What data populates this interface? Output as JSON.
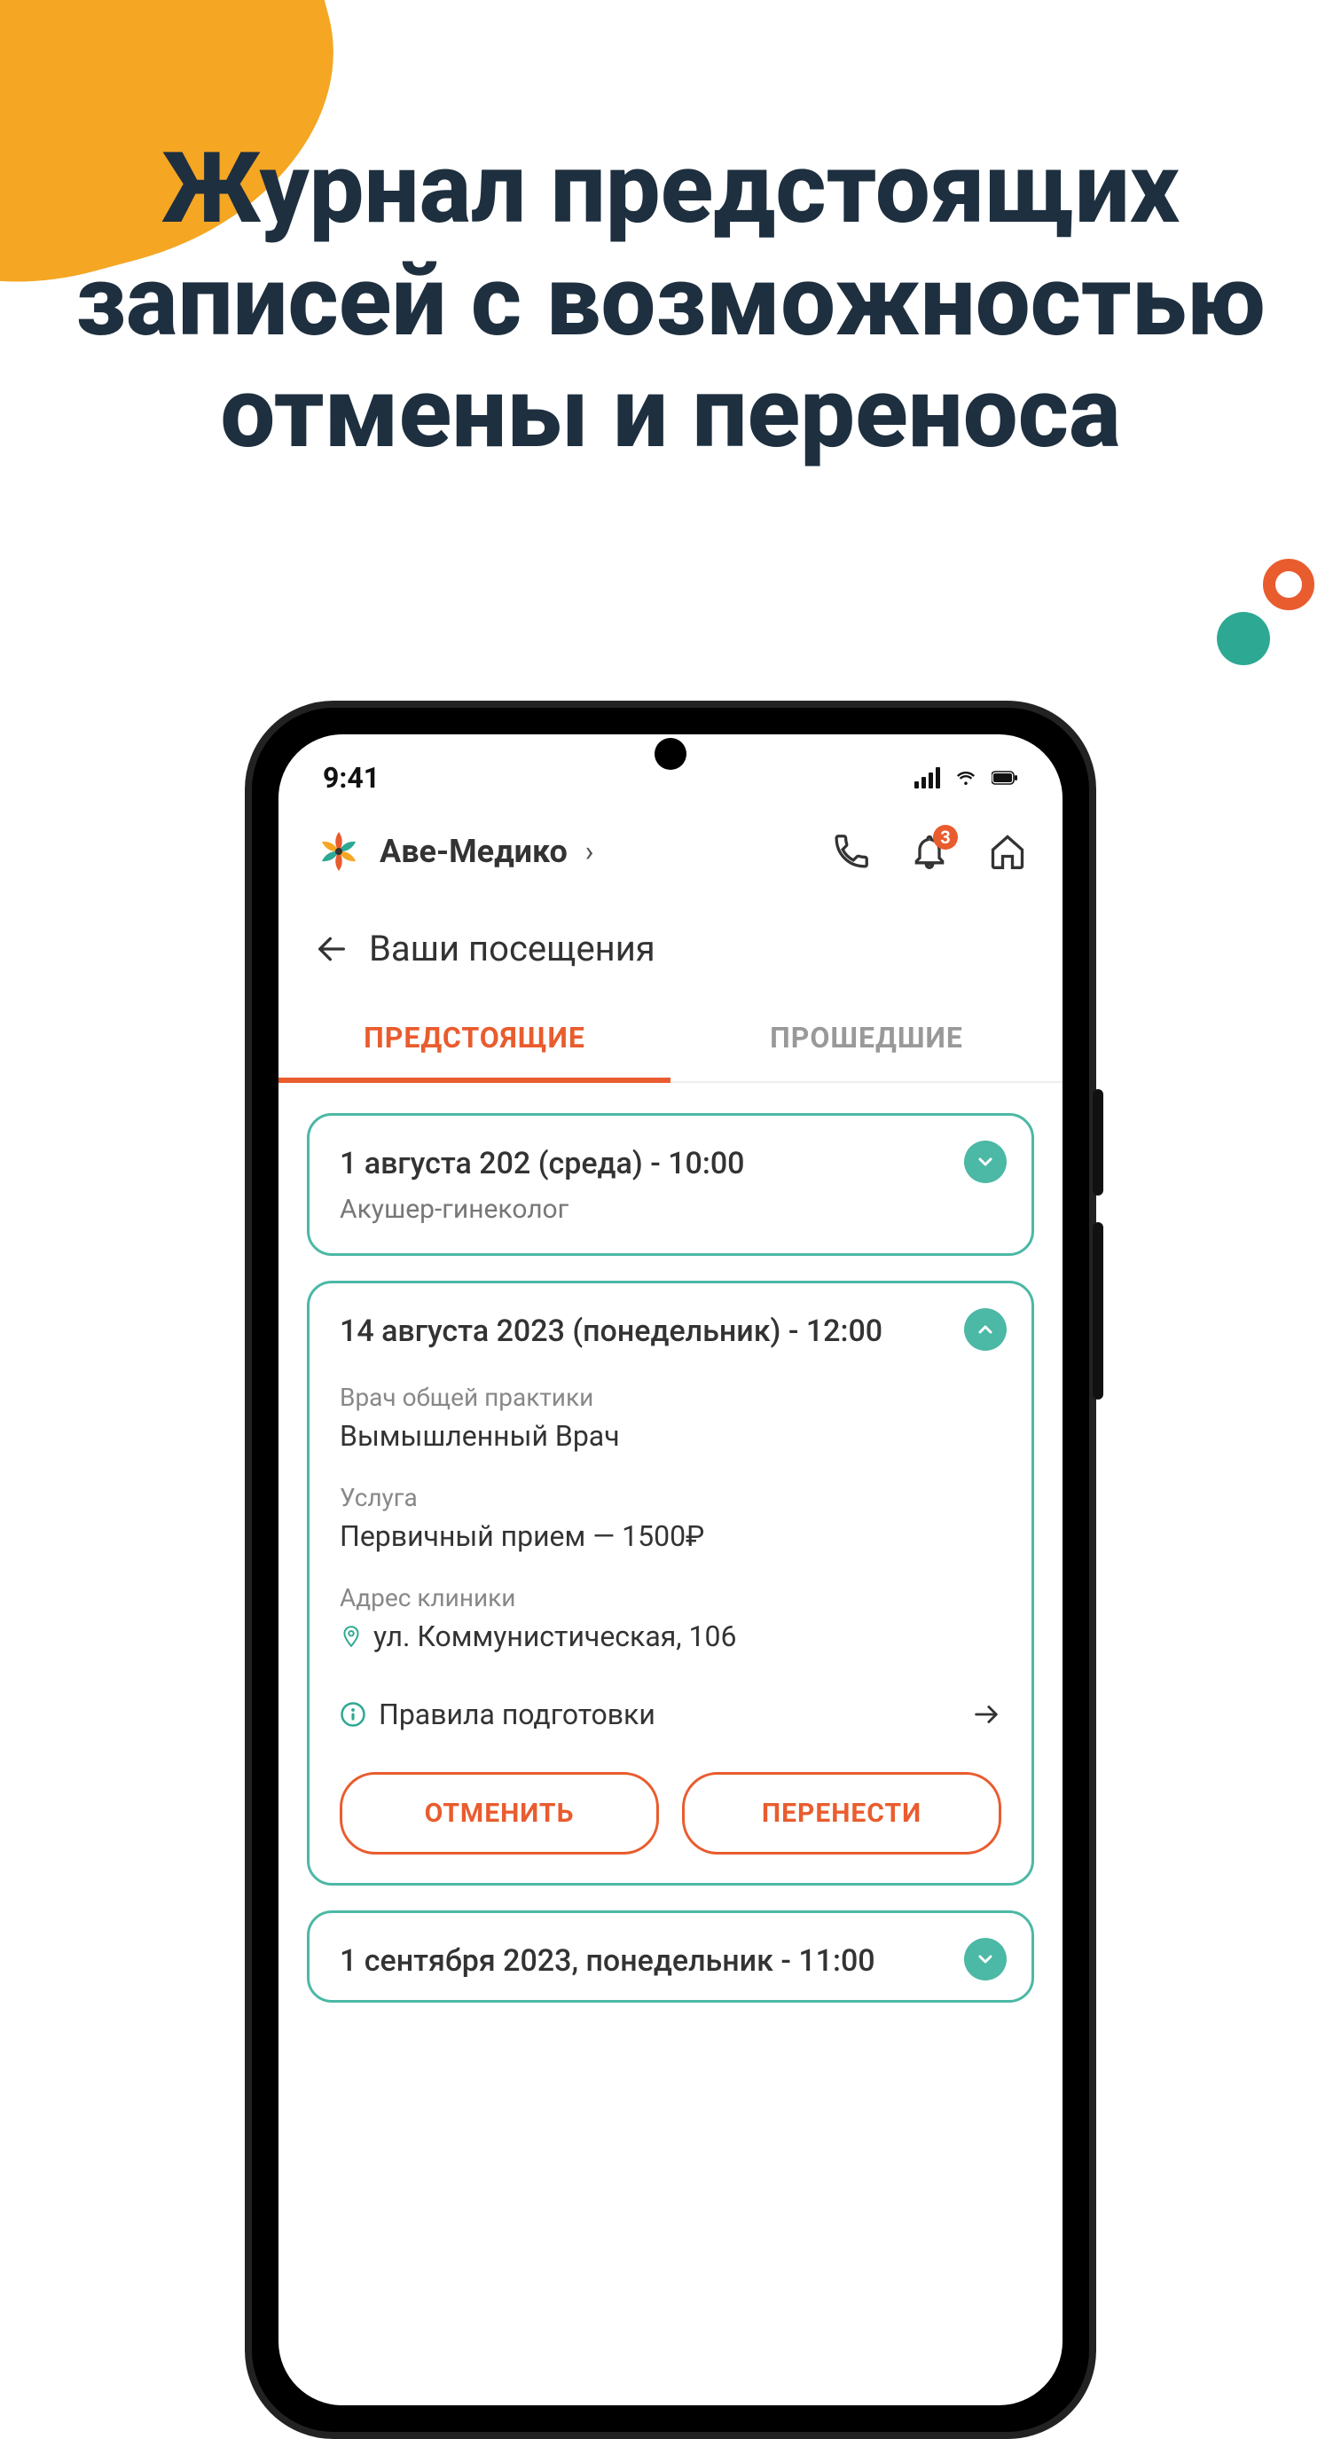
{
  "headline": "Журнал предстоящих записей с возможностью отмены и переноса",
  "statusBar": {
    "time": "9:41"
  },
  "header": {
    "brand": "Аве-Медико",
    "notificationCount": "3"
  },
  "page": {
    "title": "Ваши посещения"
  },
  "tabs": {
    "upcoming": "ПРЕДСТОЯЩИЕ",
    "past": "ПРОШЕДШИЕ"
  },
  "cards": [
    {
      "title": "1 августа 202 (среда) - 10:00",
      "subtitle": "Акушер-гинеколог"
    },
    {
      "title": "14 августа 2023 (понедельник) - 12:00",
      "doctorLabel": "Врач общей практики",
      "doctorName": "Вымышленный Врач",
      "serviceLabel": "Услуга",
      "serviceValue": "Первичный прием — 1500₽",
      "addressLabel": "Адрес клиники",
      "addressValue": "ул. Коммунистическая, 106",
      "prep": "Правила подготовки",
      "cancel": "ОТМЕНИТЬ",
      "reschedule": "ПЕРЕНЕСТИ"
    },
    {
      "title": "1 сентября 2023, понедельник - 11:00"
    }
  ]
}
